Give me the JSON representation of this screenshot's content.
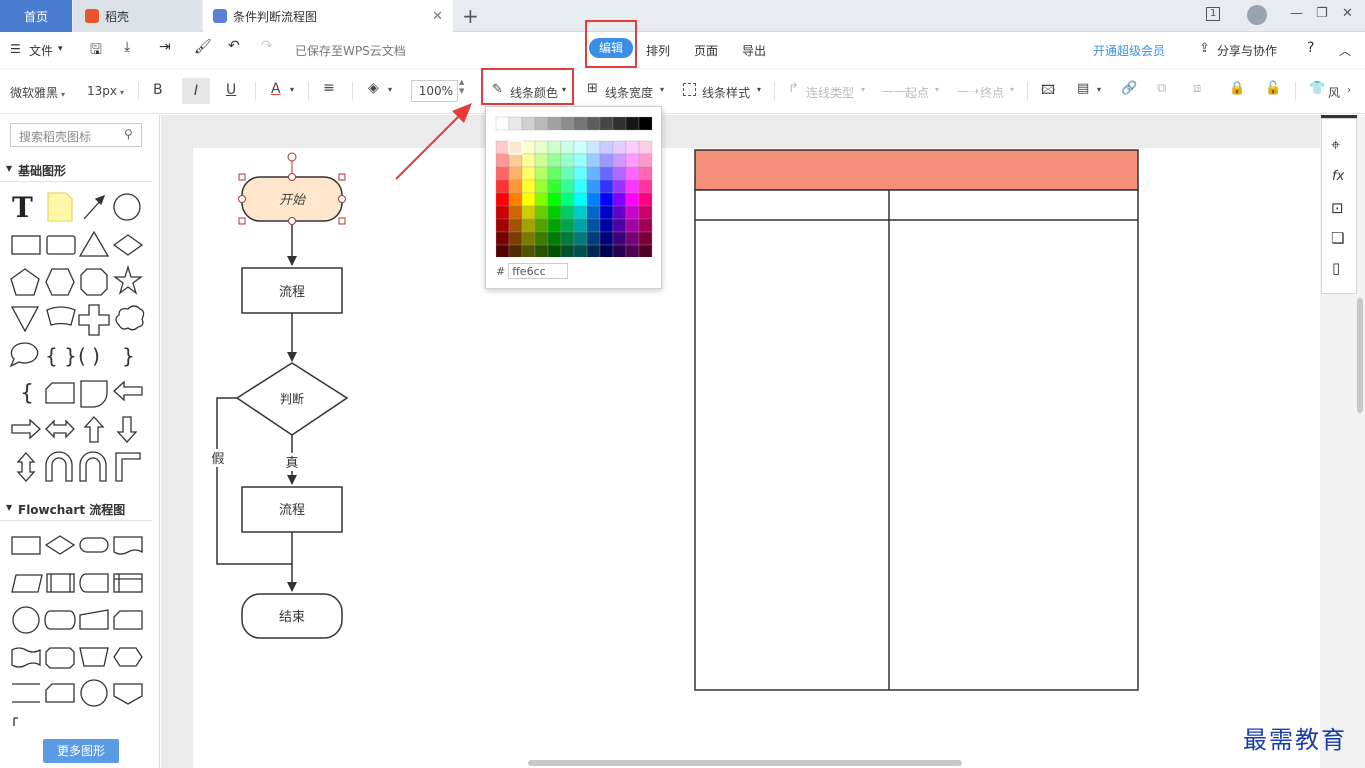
{
  "tabs": {
    "home": "首页",
    "wps": "稻壳",
    "doc": "条件判断流程图",
    "page_indicator": "1"
  },
  "menu": {
    "file": "文件",
    "saved_status": "已保存至WPS云文档",
    "edit": "编辑",
    "arrange": "排列",
    "page": "页面",
    "export": "导出",
    "vip": "开通超级会员",
    "share": "分享与协作",
    "help": "?"
  },
  "toolbar": {
    "font": "微软雅黑",
    "size": "13px",
    "bold": "B",
    "italic": "I",
    "underline": "U",
    "font_color": "A",
    "zoom": "100%",
    "line_color": "线条颜色",
    "line_width": "线条宽度",
    "line_style": "线条样式",
    "connector_type": "连线类型",
    "start": "起点",
    "end": "终点",
    "more": "风"
  },
  "left_panel": {
    "search_placeholder": "搜索稻壳图标",
    "section_basic": "基础图形",
    "section_flowchart": "Flowchart 流程图",
    "more_shapes": "更多图形"
  },
  "flowchart": {
    "start": "开始",
    "process1": "流程",
    "decision": "判断",
    "false_label": "假",
    "true_label": "真",
    "process2": "流程",
    "end": "结束"
  },
  "color_picker": {
    "hash": "#",
    "hex_value": "ffe6cc",
    "selected_color": "#ffe6cc"
  },
  "colors": {
    "accent": "#3a8ee6",
    "table_header": "#f4907a",
    "start_fill": "#ffe6cc",
    "annotation_red": "#e83a3a"
  },
  "watermark": "最需教育"
}
